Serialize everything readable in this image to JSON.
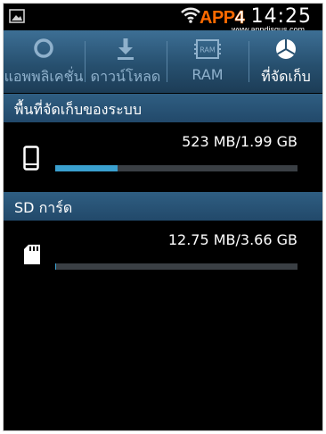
{
  "status_bar": {
    "time": "14:25",
    "icons": [
      "gallery-icon",
      "wifi-icon"
    ],
    "watermark_logo": "APP4",
    "watermark_url": "www.appdisqus.com"
  },
  "tabs": [
    {
      "label": "แอพพลิเคชั่น",
      "icon": "progress-ring-icon",
      "selected": false
    },
    {
      "label": "ดาวน์โหลด",
      "icon": "download-icon",
      "selected": false
    },
    {
      "label": "RAM",
      "icon": "ram-chip-icon",
      "selected": false
    },
    {
      "label": "ที่จัดเก็บ",
      "icon": "pie-chart-icon",
      "selected": true
    }
  ],
  "ram_chip_text": "RAM",
  "sections": [
    {
      "title": "พื้นที่จัดเก็บของระบบ",
      "icon": "phone-icon",
      "usage": "523 MB/1.99 GB",
      "used_fraction": 0.256
    },
    {
      "title": "SD การ์ด",
      "icon": "sd-card-icon",
      "usage": "12.75 MB/3.66 GB",
      "used_fraction": 0.003
    }
  ],
  "colors": {
    "accent": "#3aa0cf",
    "tab_bar": "#27506f",
    "background": "#000000"
  }
}
